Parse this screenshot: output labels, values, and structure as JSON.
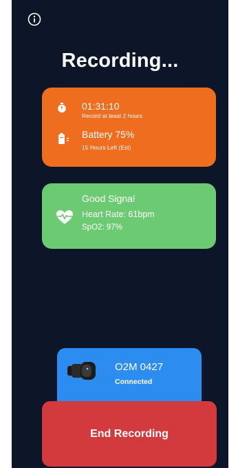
{
  "header": {
    "title": "Recording...",
    "info_icon": "info-circle-icon"
  },
  "session": {
    "timer_icon": "stopwatch-icon",
    "elapsed": "01:31:10",
    "elapsed_hint": "Record at least 2 hours",
    "battery_icon": "battery-icon",
    "battery": "Battery 75%",
    "battery_hint": "15 Hours Left (Est)"
  },
  "signal": {
    "icon": "heart-pulse-icon",
    "status": "Good Signal",
    "heart_rate": "Heart Rate: 61bpm",
    "spo2": "SpO2: 97%"
  },
  "device": {
    "icon": "ring-sensor-icon",
    "name": "O2M 0427",
    "status": "Connected"
  },
  "actions": {
    "end_label": "End Recording"
  },
  "colors": {
    "background": "#0c1628",
    "session_card": "#ee6d1e",
    "signal_card": "#6ccb72",
    "device_card": "#2d8cf0",
    "end_button": "#d23a3e"
  }
}
